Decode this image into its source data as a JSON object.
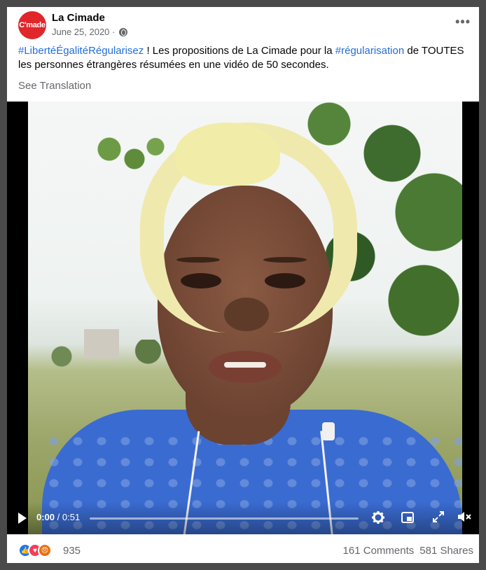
{
  "post": {
    "page_name": "La Cimade",
    "avatar_text": "C'made",
    "date": "June 25, 2020 ·",
    "more_label": "•••",
    "text": {
      "hashtag1": "#LibertéÉgalitéRégularisez",
      "part1": " ! Les propositions de La Cimade pour la ",
      "hashtag2": "#régularisation",
      "part2": " de TOUTES les personnes étrangères résumées en une vidéo de 50 secondes."
    },
    "see_translation": "See Translation"
  },
  "video": {
    "time_current": "0:00",
    "time_total": "/ 0:51",
    "progress": 0,
    "icons": [
      "play-icon",
      "settings-icon",
      "picture-in-picture-icon",
      "fullscreen-icon",
      "volume-icon"
    ]
  },
  "footer": {
    "reaction_count": "935",
    "comments": "161 Comments",
    "shares": "581 Shares",
    "reaction_icons": [
      "like-icon",
      "love-icon",
      "angry-icon"
    ]
  },
  "colors": {
    "hashtag": "#216fdb",
    "brand_red": "#e0262b",
    "secondary_text": "#65676b"
  }
}
